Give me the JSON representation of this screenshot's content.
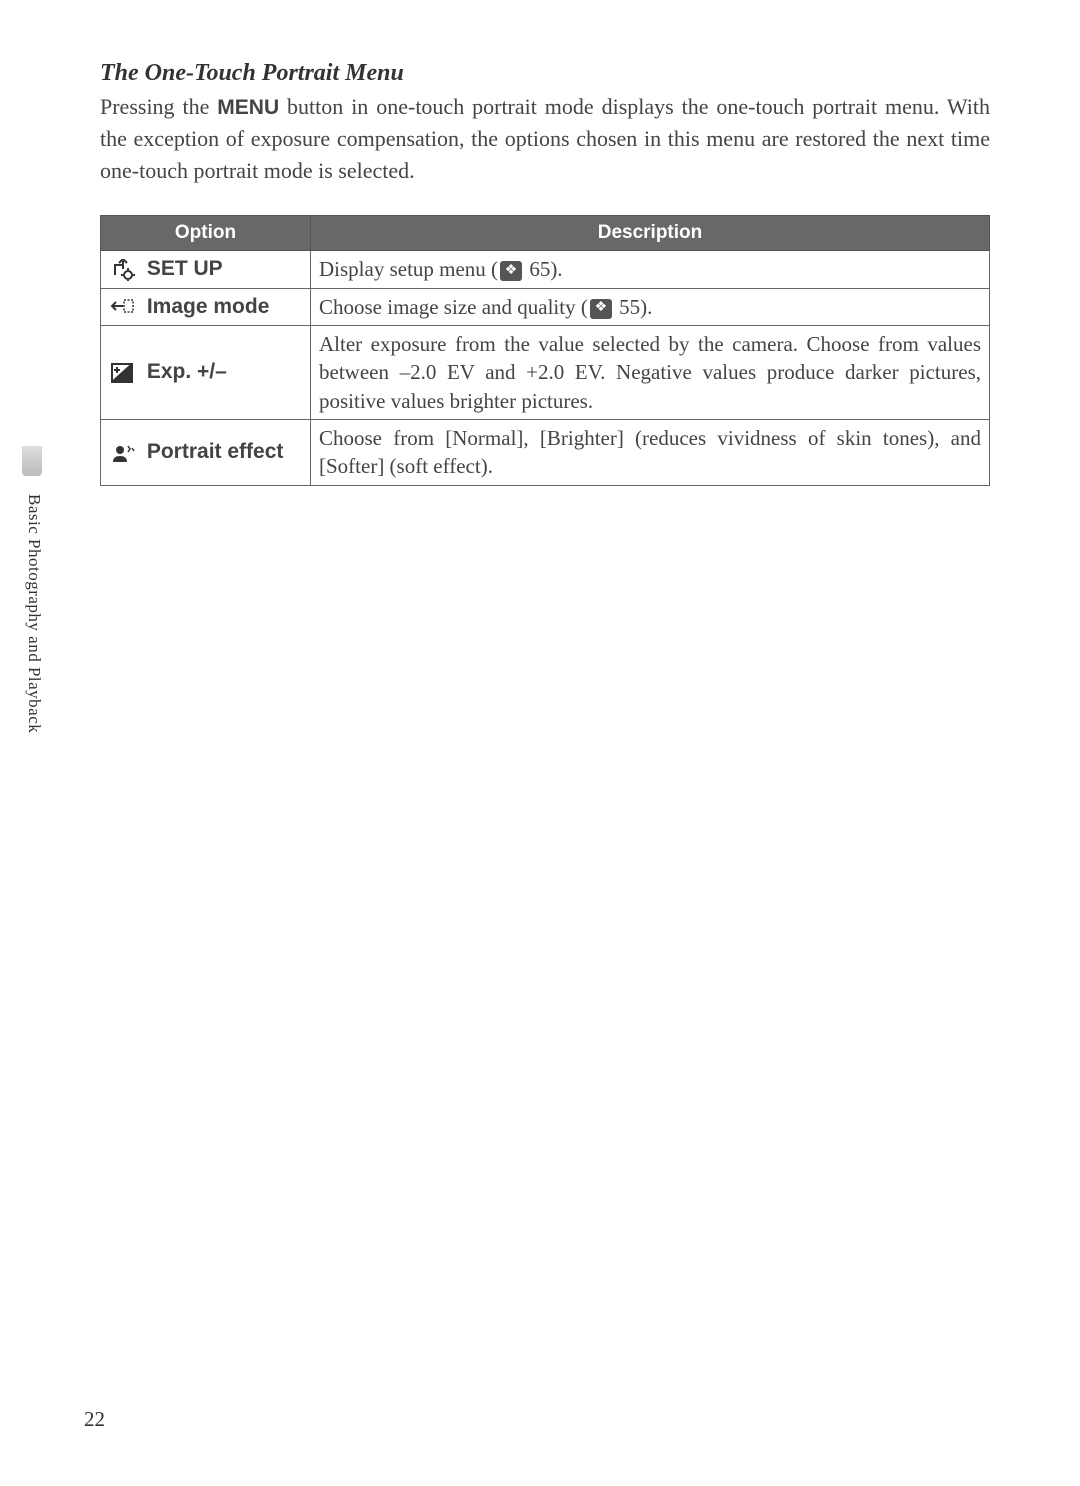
{
  "section_title": "The One-Touch Portrait Menu",
  "intro_part1": "Pressing the ",
  "menu_label": "MENU",
  "intro_part2": " button in one-touch portrait mode displays the one-touch portrait menu.  With the exception of exposure compensation, the options chosen in this menu are restored the next time one-touch portrait mode is selected.",
  "table": {
    "headers": {
      "option": "Option",
      "description": "Description"
    },
    "rows": [
      {
        "icon": "setup-icon",
        "option": "SET UP",
        "desc_prefix": "Display setup menu (",
        "desc_ref": "65",
        "desc_suffix": ")."
      },
      {
        "icon": "image-mode-icon",
        "option": "Image mode",
        "desc_prefix": "Choose image size and quality (",
        "desc_ref": "55",
        "desc_suffix": ")."
      },
      {
        "icon": "exposure-icon",
        "option": "Exp. +/–",
        "desc": "Alter exposure from the value selected by the camera.  Choose from values between –2.0 EV and +2.0 EV.  Negative values produce darker pictures, positive values brighter pictures."
      },
      {
        "icon": "portrait-effect-icon",
        "option": "Portrait effect",
        "desc": "Choose from [Normal], [Brighter] (reduces vividness of skin tones), and [Softer] (soft effect)."
      }
    ]
  },
  "side_label": "Basic Photography and Playback",
  "page_number": "22",
  "ref_glyph": "❖"
}
